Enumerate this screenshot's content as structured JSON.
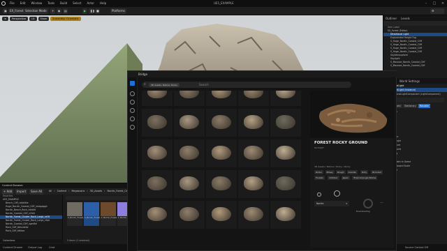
{
  "app": {
    "window_title": "UE5_EXAMPLE",
    "menu": [
      "File",
      "Edit",
      "Window",
      "Tools",
      "Build",
      "Select",
      "Actor",
      "Help"
    ],
    "level_tab": "EX_Forest",
    "mode_selector": "Selection Mode",
    "platforms_label": "Platforms"
  },
  "viewport": {
    "view_mode": "Perspective",
    "lit_mode": "Lit",
    "show_label": "Show",
    "realtime_label": "Scalability: Cinematic"
  },
  "outliner": {
    "tabs": [
      "Outliner",
      "Levels"
    ],
    "header": "Item Label",
    "rows": [
      "EX_Forest (Editor)",
      "Directional Light",
      "Exponential Height Fog",
      "S_Huge_Nordic_Coastal_Cliff",
      "S_Huge_Nordic_Coastal_Cliff",
      "S_Huge_Nordic_Coastal_Cliff",
      "S_Huge_Nordic_Coastal_Cliff",
      "SkyAtmosphere",
      "SkyLight",
      "S_Massive_Nordic_Coastal_Cliff",
      "S_Massive_Nordic_Coastal_Cliff"
    ],
    "selected_index": 1
  },
  "details": {
    "tabs": [
      "Details",
      "World Settings"
    ],
    "actor_name": "DirectionalLight",
    "component_root": "DirectionalLight (Instance)",
    "component_child": "DirectionalLightComponent (LightComponent)",
    "rows": [
      "Transform",
      "Location",
      "Rotation",
      "Scale",
      "Light",
      "Intensity",
      "Light Color",
      "Source Angle",
      "Temperature",
      "Affects World",
      "Rendering",
      "Visible",
      "Actor Hidden In Game",
      "Editor Billboard Scale",
      "Advanced"
    ],
    "mobility_options": [
      "Static",
      "Stationary",
      "Movable"
    ],
    "rendering_values": [
      "1.0"
    ]
  },
  "content_browser": {
    "tab": "Content Browser",
    "add_label": "+ Add",
    "import_label": "Import",
    "save_label": "Save All",
    "path": [
      "All",
      "Content",
      "Megascans",
      "3D_Assets",
      "Nordic_Forest_Cluster_Rock_Large"
    ],
    "favorites_label": "Favorites",
    "project_label": "UE5_EXAMPLE",
    "tree": [
      "Beach_Cliff_rxkbNhe",
      "Huge_Nordic_Coastal_Cliff_vewgagge",
      "Nordic_Beach_Rock_tdirbfd",
      "Nordic_Coastal_Cliff_vi3d4",
      "Nordic_Forest_Cluster_Rock_Large_ve3t",
      "Nordic_Forest_Cluster_Rock_Large_vfqd",
      "Nordic_Coastal_Cliff_ugm8ai",
      "Rock_Cliff_tbhuwkfw",
      "Rock_Cliff_tdtkaa"
    ],
    "tree_selected_index": 4,
    "assets": [
      {
        "name": "S_Nordic_Forest_Clust..."
      },
      {
        "name": "S_Nordic_Forest_Clust..."
      },
      {
        "name": "T_Nordic_Forest_Clust..."
      },
      {
        "name": "T_Nordic_Forest_Clust..."
      },
      {
        "name": "T_Nordic_Forest_Clust..."
      }
    ],
    "status": "5 items (1 selected)",
    "collections_label": "Collections"
  },
  "bridge": {
    "title": "Bridge",
    "search_chip": "3D Assets, Nature, Rocks",
    "search_placeholder": "Search",
    "asset_title": "FOREST ROCKY GROUND",
    "asset_id": "tbL53ljRF",
    "breadcrumb": "3D Assets / Nature / Rocky / Rocky",
    "tags": [
      "Rocks",
      "Mossy",
      "Rough",
      "Granite",
      "Dirty",
      "Brooded",
      "Forests",
      "Outdoor",
      "Japan",
      "Tropical Jungle Biome"
    ],
    "quality": "Nanite",
    "download_label": "Downloading"
  },
  "statusbar": {
    "items": [
      "Content Drawer",
      "Output Log",
      "Cmd"
    ],
    "right": "Source Control Off"
  }
}
